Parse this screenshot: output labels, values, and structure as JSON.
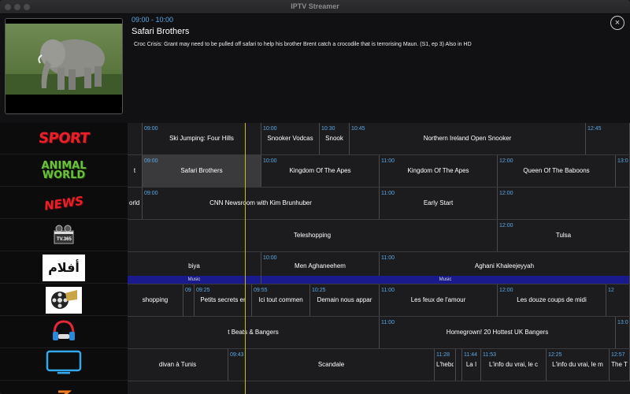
{
  "window": {
    "title": "IPTV Streamer"
  },
  "program": {
    "time": "09:00 - 10:00",
    "title": "Safari Brothers",
    "description": "Croc Crisis: Grant may need to be pulled off safari to help his brother Brent catch a crocodile that is terrorising Maun. (S1, ep 3) Also in HD"
  },
  "close_glyph": "×",
  "channels": [
    {
      "logo_text": "SPORT",
      "color": "#e8202a"
    },
    {
      "logo_text": "ANIMAL WORLD",
      "color": "#6cc13b"
    },
    {
      "logo_text": "NEWS",
      "color": "#e8202a"
    },
    {
      "logo_text": "TV.365",
      "icon": "film-camera-icon"
    },
    {
      "logo_text": "أفلام",
      "color": "#d8202a"
    },
    {
      "logo_text": "",
      "icon": "film-reel-icon"
    },
    {
      "logo_text": "",
      "icon": "headphones-icon"
    },
    {
      "logo_text": "",
      "icon": "tv-icon"
    },
    {
      "logo_text": "",
      "icon": "orange-logo-icon"
    }
  ],
  "guide": [
    {
      "cells": [
        {
          "time": "",
          "title": ""
        },
        {
          "time": "09:00",
          "title": "Ski Jumping: Four Hills"
        },
        {
          "time": "10:00",
          "title": "Snooker Vodcas"
        },
        {
          "time": "10:30",
          "title": "Snook"
        },
        {
          "time": "10:45",
          "title": "Northern Ireland Open Snooker"
        },
        {
          "time": "12:45",
          "title": ""
        }
      ]
    },
    {
      "cells": [
        {
          "time": "",
          "title": "t"
        },
        {
          "time": "09:00",
          "title": "Safari Brothers"
        },
        {
          "time": "10:00",
          "title": "Kingdom Of The Apes"
        },
        {
          "time": "11:00",
          "title": "Kingdom Of The Apes"
        },
        {
          "time": "12:00",
          "title": "Queen Of The Baboons"
        },
        {
          "time": "13:0",
          "title": ""
        }
      ]
    },
    {
      "cells": [
        {
          "time": "",
          "title": "orld S"
        },
        {
          "time": "09:00",
          "title": "CNN Newsroom with Kim Brunhuber"
        },
        {
          "time": "11:00",
          "title": "Early Start"
        },
        {
          "time": "12:00",
          "title": ""
        }
      ]
    },
    {
      "cells": [
        {
          "time": "",
          "title": "Teleshopping"
        },
        {
          "time": "12:00",
          "title": "Tulsa"
        }
      ]
    },
    {
      "cells": [
        {
          "time": "",
          "title": "biya"
        },
        {
          "time": "10:00",
          "title": "Men Aghaneehem"
        },
        {
          "time": "11:00",
          "title": "Aghani Khaleejeyyah"
        }
      ],
      "genres": [
        "Music",
        "Music"
      ]
    },
    {
      "cells": [
        {
          "time": "",
          "title": "shopping"
        },
        {
          "time": "09",
          "title": ""
        },
        {
          "time": "09:25",
          "title": "Petits secrets er"
        },
        {
          "time": "09:55",
          "title": "Ici tout commen"
        },
        {
          "time": "10:25",
          "title": "Demain nous appar"
        },
        {
          "time": "11:00",
          "title": "Les feux de l'amour"
        },
        {
          "time": "12:00",
          "title": "Les douze coups de midi"
        },
        {
          "time": "12",
          "title": ""
        }
      ]
    },
    {
      "cells": [
        {
          "time": "",
          "title": "t Beats & Bangers"
        },
        {
          "time": "11:00",
          "title": "Homegrown! 20 Hottest UK Bangers"
        },
        {
          "time": "13:0",
          "title": ""
        }
      ]
    },
    {
      "cells": [
        {
          "time": "",
          "title": "divan à Tunis"
        },
        {
          "time": "09:43",
          "title": "Scandale"
        },
        {
          "time": "11:28",
          "title": "L'hebd"
        },
        {
          "time": "",
          "title": ""
        },
        {
          "time": "11:44",
          "title": "La I"
        },
        {
          "time": "11:53",
          "title": "L'info du vrai, le c"
        },
        {
          "time": "12:25",
          "title": "L'info du vrai, le m"
        },
        {
          "time": "12:57",
          "title": "The T"
        }
      ]
    }
  ]
}
